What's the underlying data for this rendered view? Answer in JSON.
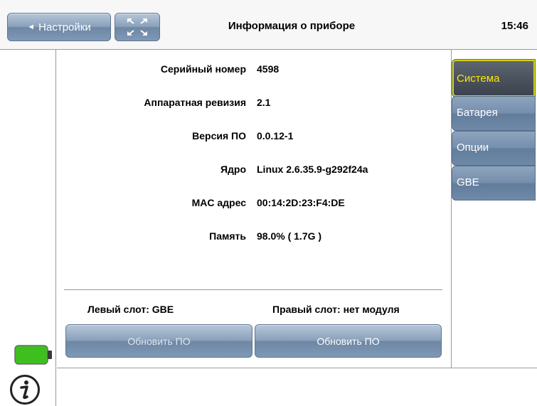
{
  "header": {
    "back_label": "Настройки",
    "title": "Информация о приборе",
    "time": "15:46"
  },
  "info": [
    {
      "label": "Серийный номер",
      "value": "4598"
    },
    {
      "label": "Аппаратная ревизия",
      "value": "2.1"
    },
    {
      "label": "Версия ПО",
      "value": "0.0.12-1"
    },
    {
      "label": "Ядро",
      "value": "Linux 2.6.35.9-g292f24a"
    },
    {
      "label": "MAC адрес",
      "value": "00:14:2D:23:F4:DE"
    },
    {
      "label": "Память",
      "value": "98.0% ( 1.7G )"
    }
  ],
  "slots": {
    "left": "Левый слот: GBE",
    "right": "Правый слот: нет модуля"
  },
  "buttons": {
    "update_left": "Обновить ПО",
    "update_right": "Обновить ПО"
  },
  "tabs": [
    {
      "label": "Система",
      "active": true
    },
    {
      "label": "Батарея",
      "active": false
    },
    {
      "label": "Опции",
      "active": false
    },
    {
      "label": "GBE",
      "active": false
    }
  ],
  "colors": {
    "battery": "#3fbf1f",
    "active_tab_text": "#ffe600"
  },
  "icons": [
    "back-arrow-icon",
    "expand-icon",
    "battery-icon",
    "info-icon"
  ]
}
